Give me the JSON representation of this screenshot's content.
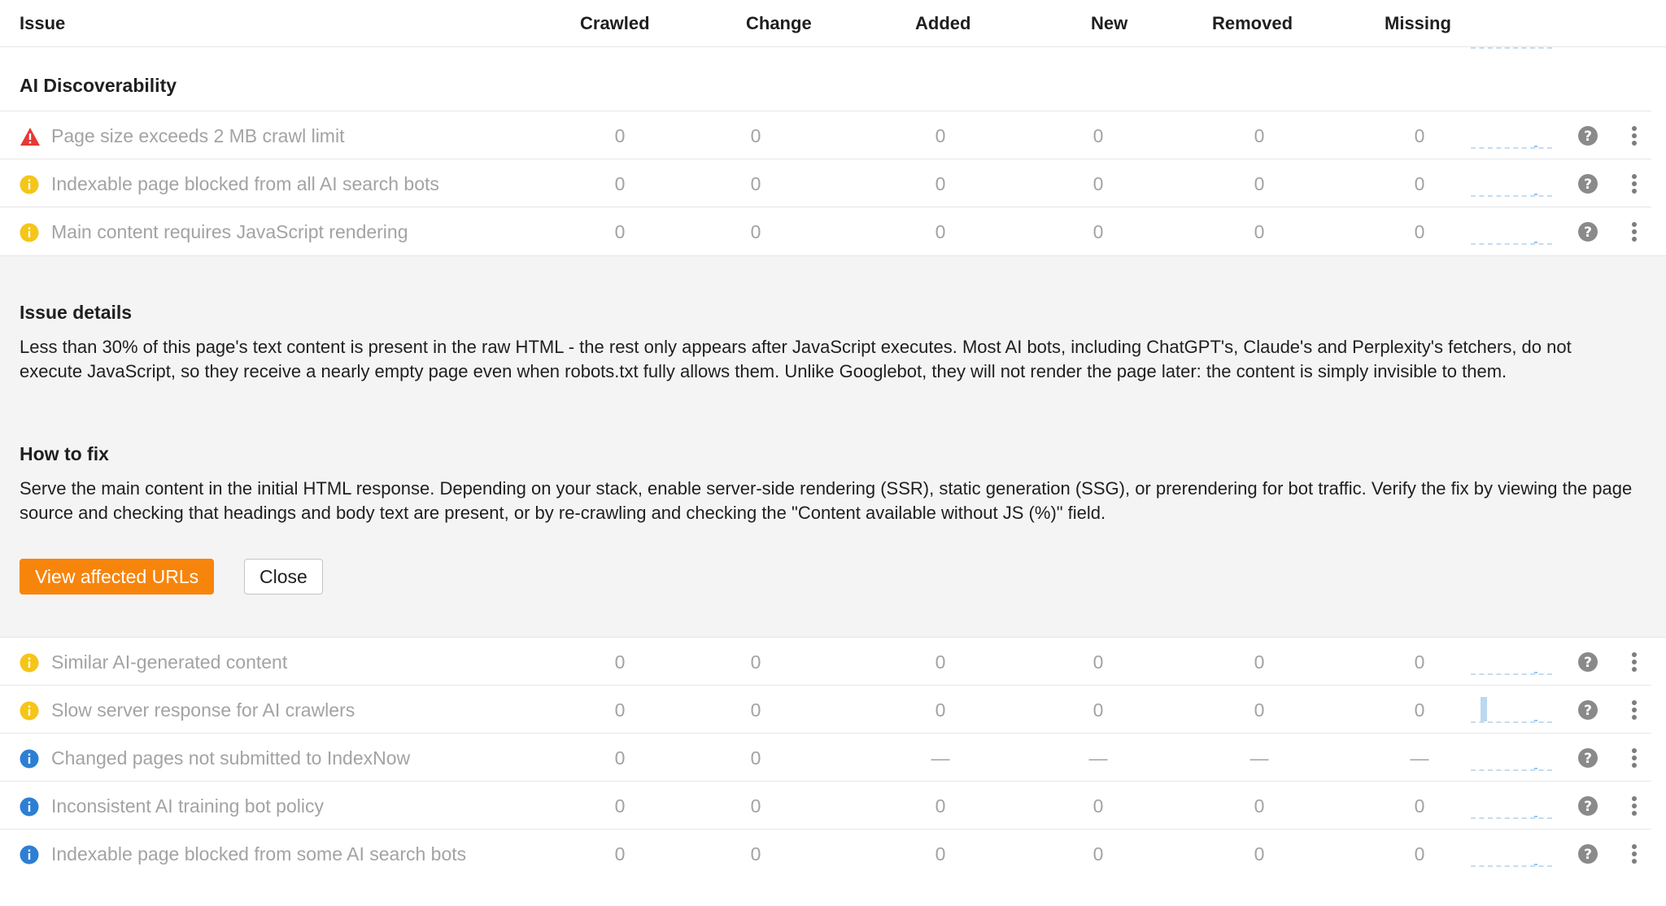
{
  "columns": {
    "issue": "Issue",
    "crawled": "Crawled",
    "change": "Change",
    "added": "Added",
    "new": "New",
    "removed": "Removed",
    "missing": "Missing"
  },
  "section": {
    "title": "AI Discoverability"
  },
  "rows_top": [
    {
      "severity": "error",
      "name": "Page size exceeds 2 MB crawl limit",
      "crawled": "0",
      "change": "0",
      "added": "0",
      "new": "0",
      "removed": "0",
      "missing": "0"
    },
    {
      "severity": "warning",
      "name": "Indexable page blocked from all AI search bots",
      "crawled": "0",
      "change": "0",
      "added": "0",
      "new": "0",
      "removed": "0",
      "missing": "0"
    },
    {
      "severity": "warning",
      "name": "Main content requires JavaScript rendering",
      "crawled": "0",
      "change": "0",
      "added": "0",
      "new": "0",
      "removed": "0",
      "missing": "0"
    }
  ],
  "details": {
    "issue_heading": "Issue details",
    "issue_text": "Less than 30% of this page's text content is present in the raw HTML - the rest only appears after JavaScript executes. Most AI bots, including ChatGPT's, Claude's and Perplexity's fetchers, do not execute JavaScript, so they receive a nearly empty page even when robots.txt fully allows them. Unlike Googlebot, they will not render the page later: the content is simply invisible to them.",
    "fix_heading": "How to fix",
    "fix_text": "Serve the main content in the initial HTML response. Depending on your stack, enable server-side rendering (SSR), static generation (SSG), or prerendering for bot traffic. Verify the fix by viewing the page source and checking that headings and body text are present, or by re-crawling and checking the \"Content available without JS (%)\" field.",
    "view_button": "View affected URLs",
    "close_button": "Close"
  },
  "rows_bottom": [
    {
      "severity": "warning",
      "name": "Similar AI-generated content",
      "crawled": "0",
      "change": "0",
      "added": "0",
      "new": "0",
      "removed": "0",
      "missing": "0"
    },
    {
      "severity": "warning",
      "name": "Slow server response for AI crawlers",
      "crawled": "0",
      "change": "0",
      "added": "0",
      "new": "0",
      "removed": "0",
      "missing": "0"
    },
    {
      "severity": "notice",
      "name": "Changed pages not submitted to IndexNow",
      "crawled": "0",
      "change": "0",
      "added": "—",
      "new": "—",
      "removed": "—",
      "missing": "—"
    },
    {
      "severity": "notice",
      "name": "Inconsistent AI training bot policy",
      "crawled": "0",
      "change": "0",
      "added": "0",
      "new": "0",
      "removed": "0",
      "missing": "0"
    },
    {
      "severity": "notice",
      "name": "Indexable page blocked from some AI search bots",
      "crawled": "0",
      "change": "0",
      "added": "0",
      "new": "0",
      "removed": "0",
      "missing": "0"
    }
  ],
  "colors": {
    "error": "#e53935",
    "warning": "#f5c518",
    "notice": "#2d7fd3",
    "accent": "#f7850c"
  }
}
